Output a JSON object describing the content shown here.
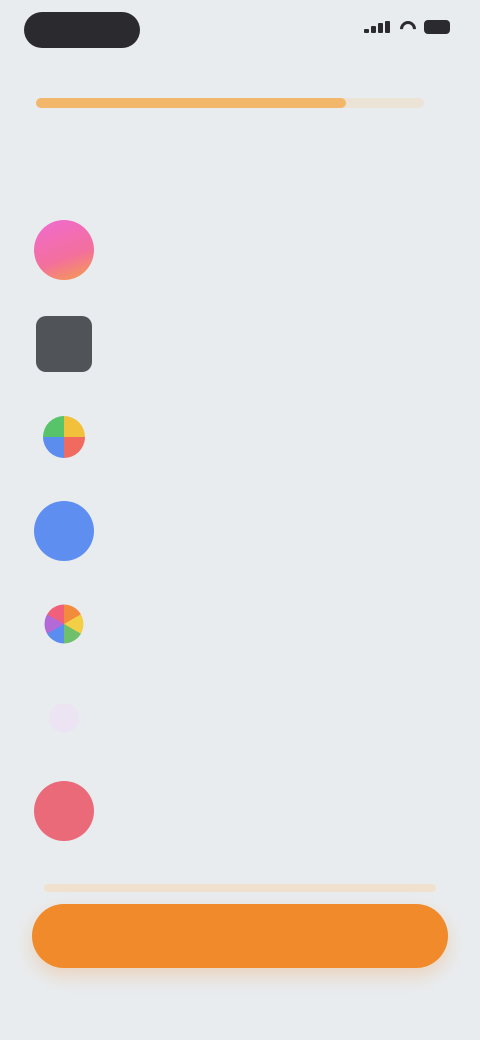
{
  "status_bar": {
    "time": ""
  },
  "onboarding": {
    "progress": 0.8
  },
  "section": {
    "heading": ""
  },
  "apps": [
    {
      "name": "",
      "description": "",
      "icon": "pink-gradient-app-icon",
      "color": "#f06bd0"
    },
    {
      "name": "",
      "description": "",
      "icon": "dark-app-icon",
      "color": "#505357"
    },
    {
      "name": "",
      "description": "",
      "icon": "pinwheel-app-icon",
      "color": "#f2c13b"
    },
    {
      "name": "",
      "description": "",
      "icon": "blue-app-icon",
      "color": "#5e8ff0"
    },
    {
      "name": "",
      "description": "",
      "icon": "flower-app-icon",
      "color": "#f28b3c"
    },
    {
      "name": "",
      "description": "",
      "icon": "faint-app-icon",
      "color": "#ece4f2"
    },
    {
      "name": "",
      "description": "",
      "icon": "red-app-icon",
      "color": "#ea6a7a"
    }
  ],
  "footer": {
    "button_label": ""
  },
  "colors": {
    "accent": "#f08a2a",
    "background": "#e9ecef"
  }
}
